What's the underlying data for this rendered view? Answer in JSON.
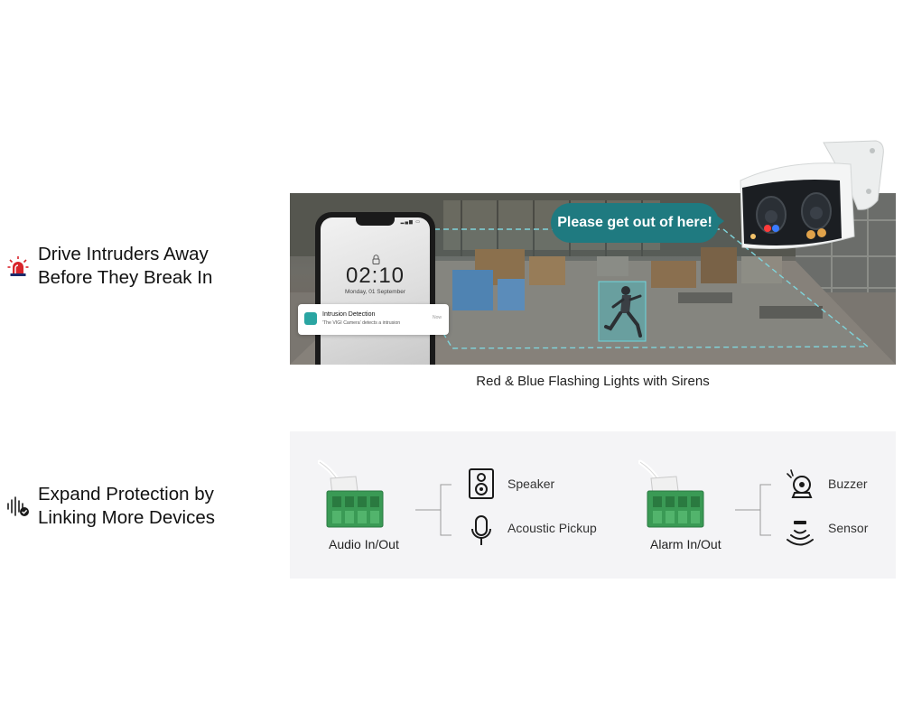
{
  "features": [
    {
      "icon": "siren-icon",
      "title_line1": "Drive Intruders Away",
      "title_line2": "Before They Break In",
      "accent": "#d8232a"
    },
    {
      "icon": "sound-wave-check-icon",
      "title_line1": "Expand Protection by",
      "title_line2": "Linking More Devices"
    }
  ],
  "scene": {
    "phone": {
      "clock": "02:10",
      "date": "Monday, 01 September",
      "notification_title": "Intrusion Detection",
      "notification_body": "'The VIGI Camera' detects a intrusion",
      "notification_time": "Now"
    },
    "speech_bubble": "Please get out of here!",
    "bubble_color": "#1f7a80",
    "caption": "Red & Blue Flashing Lights with Sirens"
  },
  "panel": {
    "groups": [
      {
        "port": "Audio In/Out",
        "devices": [
          {
            "icon": "speaker-icon",
            "label": "Speaker"
          },
          {
            "icon": "microphone-icon",
            "label": "Acoustic Pickup"
          }
        ]
      },
      {
        "port": "Alarm In/Out",
        "devices": [
          {
            "icon": "buzzer-icon",
            "label": "Buzzer"
          },
          {
            "icon": "sensor-icon",
            "label": "Sensor"
          }
        ]
      }
    ],
    "connector_color": "#3aa05a"
  }
}
